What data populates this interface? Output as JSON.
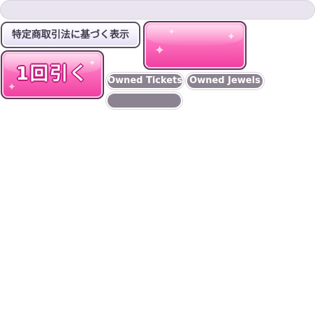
{
  "top_bar": {
    "text": ""
  },
  "legal_button": {
    "label": "特定商取引法に基づく表示"
  },
  "draw_button": {
    "label": "1回引く"
  },
  "pills": {
    "owned_tickets": "Owned Tickets",
    "owned_jewels": "Owned Jewels",
    "empty": ""
  },
  "colors": {
    "accent_pink": "#f03d9f",
    "pill_gray": "#8c8390",
    "frame_dark": "#5a3a5d"
  },
  "icons": {
    "sparkle": "sparkle-icon"
  }
}
